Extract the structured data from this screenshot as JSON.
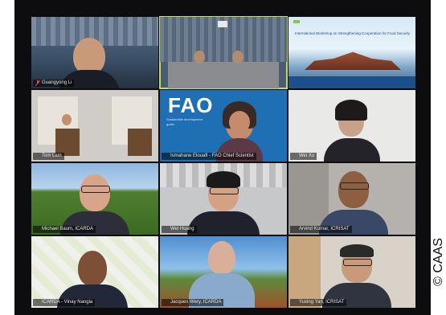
{
  "participants": [
    {
      "name": "Guangyong Li",
      "row": 0,
      "col": 0
    },
    {
      "name": "",
      "row": 0,
      "col": 1,
      "active": true
    },
    {
      "name": "",
      "row": 0,
      "col": 2,
      "slide": true
    },
    {
      "name": "Tom Lam",
      "row": 1,
      "col": 0
    },
    {
      "name": "Ismahane Elouafi - FAO Chief Scientist",
      "row": 1,
      "col": 1
    },
    {
      "name": "Wei Xu",
      "row": 1,
      "col": 2
    },
    {
      "name": "Michael Baum, ICARDA",
      "row": 2,
      "col": 0
    },
    {
      "name": "Wei Huang",
      "row": 2,
      "col": 1
    },
    {
      "name": "Arvind Kumar, ICRISAT",
      "row": 2,
      "col": 2
    },
    {
      "name": "ICARDA - Vinay Nangia",
      "row": 3,
      "col": 0
    },
    {
      "name": "Jacques Wery, ICARDA",
      "row": 3,
      "col": 1
    },
    {
      "name": "Yuxing Yan, ICRISAT",
      "row": 3,
      "col": 2
    }
  ],
  "slide": {
    "title": "International Workshop on Strengthening Cooperation for Food Security"
  },
  "fao_logo": "FAO",
  "fao_caption": "Sustainable development goals",
  "icons": {
    "mute": "mic-muted-icon"
  },
  "copyright": "© CAAS",
  "colors": {
    "active_border": "#c9d86a",
    "fao_blue": "#1f6fb5"
  }
}
